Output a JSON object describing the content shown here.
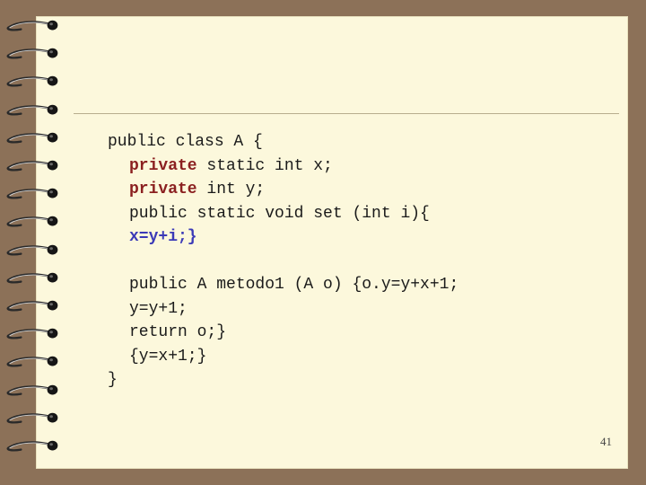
{
  "slide": {
    "page_number": "41",
    "code": {
      "l1": "public class A {",
      "l2_kw": "private",
      "l2_rest": " static int x;",
      "l3_kw": "private",
      "l3_rest": " int y;",
      "l4": "public static void set (int i){",
      "l5": "x=y+i;}",
      "l6": "public A metodo1 (A o) {o.y=y+x+1;",
      "l7": "y=y+1;",
      "l8": "return o;}",
      "l9": "{y=x+1;}",
      "l10": "}"
    }
  },
  "colors": {
    "background": "#8c7158",
    "paper": "#fcf8dc",
    "keyword": "#8b2020",
    "highlight": "#3b3ab7"
  },
  "icons": [
    "spiral-binding-ring"
  ]
}
